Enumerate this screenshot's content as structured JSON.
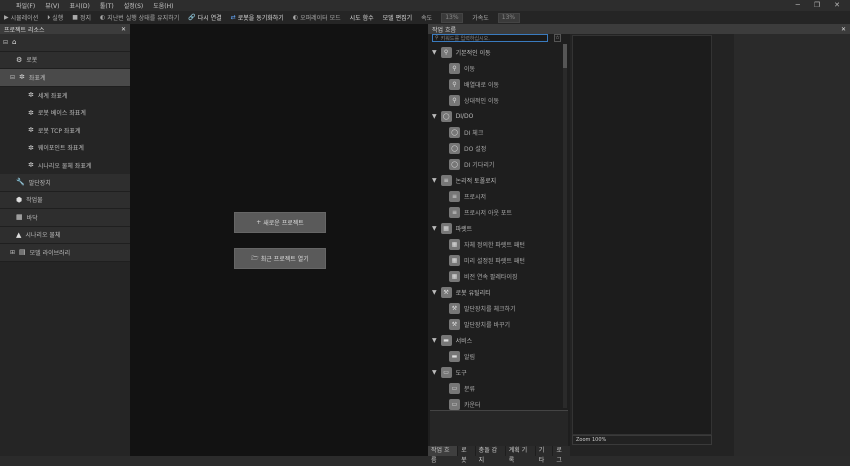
{
  "menu": [
    "파일(F)",
    "뷰(V)",
    "표시(D)",
    "툴(T)",
    "설정(S)",
    "도움(H)"
  ],
  "toolbar": {
    "simulation": "시뮬레이션",
    "run": "실행",
    "stop": "정지",
    "keep_state": "지난번 실행 상태를 유지하기",
    "reconnect": "다시 연결",
    "sync_robot": "로봇을 동기화하기",
    "operator_mode": "오퍼레이터 모드",
    "global_var": "시도 함수",
    "model_editor": "모델 편집기",
    "speed_label": "속도",
    "speed_value": "13%",
    "accel_label": "가속도",
    "accel_value": "13%"
  },
  "left_panel": {
    "title": "프로젝트 리소스",
    "items": {
      "robot": "로봇",
      "frames": "좌표계",
      "world": "세계 좌표계",
      "robot_base": "로봇 베이스 좌표계",
      "robot_tcp": "로봇 TCP 좌표계",
      "waypoint": "웨이포인트 좌표계",
      "scenario_obj": "시나리오 물체 좌표계",
      "end_effector": "말단장치",
      "workpiece": "작업물",
      "floor": "바닥",
      "scenario_body": "시나리오 물체",
      "model_library": "모델 라이브러리"
    }
  },
  "center": {
    "new_project": "새로운 프로젝트",
    "open_recent": "최근 프로젝트 열기"
  },
  "workflow": {
    "title": "작업 흐름",
    "search_placeholder": "키워드를 입력하십시오.",
    "groups": [
      {
        "label": "기본적인 이동",
        "icon": "pin",
        "items": [
          "이동",
          "배열대로 이동",
          "상대적인 이동"
        ]
      },
      {
        "label": "DI/DO",
        "icon": "circle",
        "items": [
          "DI 체크",
          "DO 설정",
          "DI 기다리기"
        ]
      },
      {
        "label": "논리적 토폴로지",
        "icon": "stack",
        "items": [
          "프로시저",
          "프로시저 아웃 포트"
        ]
      },
      {
        "label": "파렛트",
        "icon": "grid",
        "items": [
          "자체 정의한 파렛트 패턴",
          "미리 설정된 파렛트 패턴",
          "비전 연속 팔레타이징"
        ]
      },
      {
        "label": "로봇 유틸리티",
        "icon": "tool",
        "items": [
          "말단장치를 체크하기",
          "말단장치를 바꾸기"
        ]
      },
      {
        "label": "서비스",
        "icon": "folder",
        "items": [
          "알림"
        ]
      },
      {
        "label": "도구",
        "icon": "box",
        "items": [
          "분류",
          "카운터"
        ]
      }
    ],
    "tabs": [
      "작업 흐름",
      "로봇",
      "충돌 감지",
      "계획 기록",
      "기타",
      "로그"
    ]
  },
  "canvas": {
    "zoom": "Zoom 100%"
  }
}
